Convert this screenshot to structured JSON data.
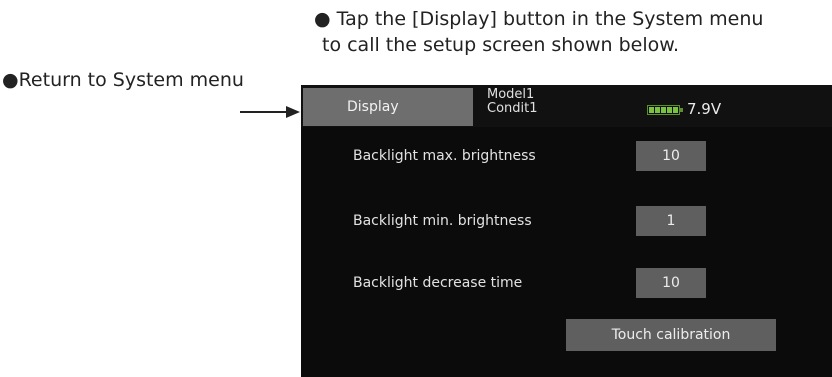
{
  "instruction": {
    "line1": "● Tap the [Display] button in the System menu",
    "line2": "to call the setup screen shown below."
  },
  "return_note": "●Return to System menu",
  "screen": {
    "header": {
      "display_button_label": "Display",
      "model_name": "Model1",
      "condition_name": "Condit1",
      "battery_voltage": "7.9V",
      "battery_icon": "battery-icon",
      "battery_color": "#7cc242"
    },
    "settings": [
      {
        "label": "Backlight max. brightness",
        "value": "10"
      },
      {
        "label": "Backlight min. brightness",
        "value": "1"
      },
      {
        "label": "Backlight decrease time",
        "value": "10"
      }
    ],
    "touch_calibration_label": "Touch calibration"
  }
}
